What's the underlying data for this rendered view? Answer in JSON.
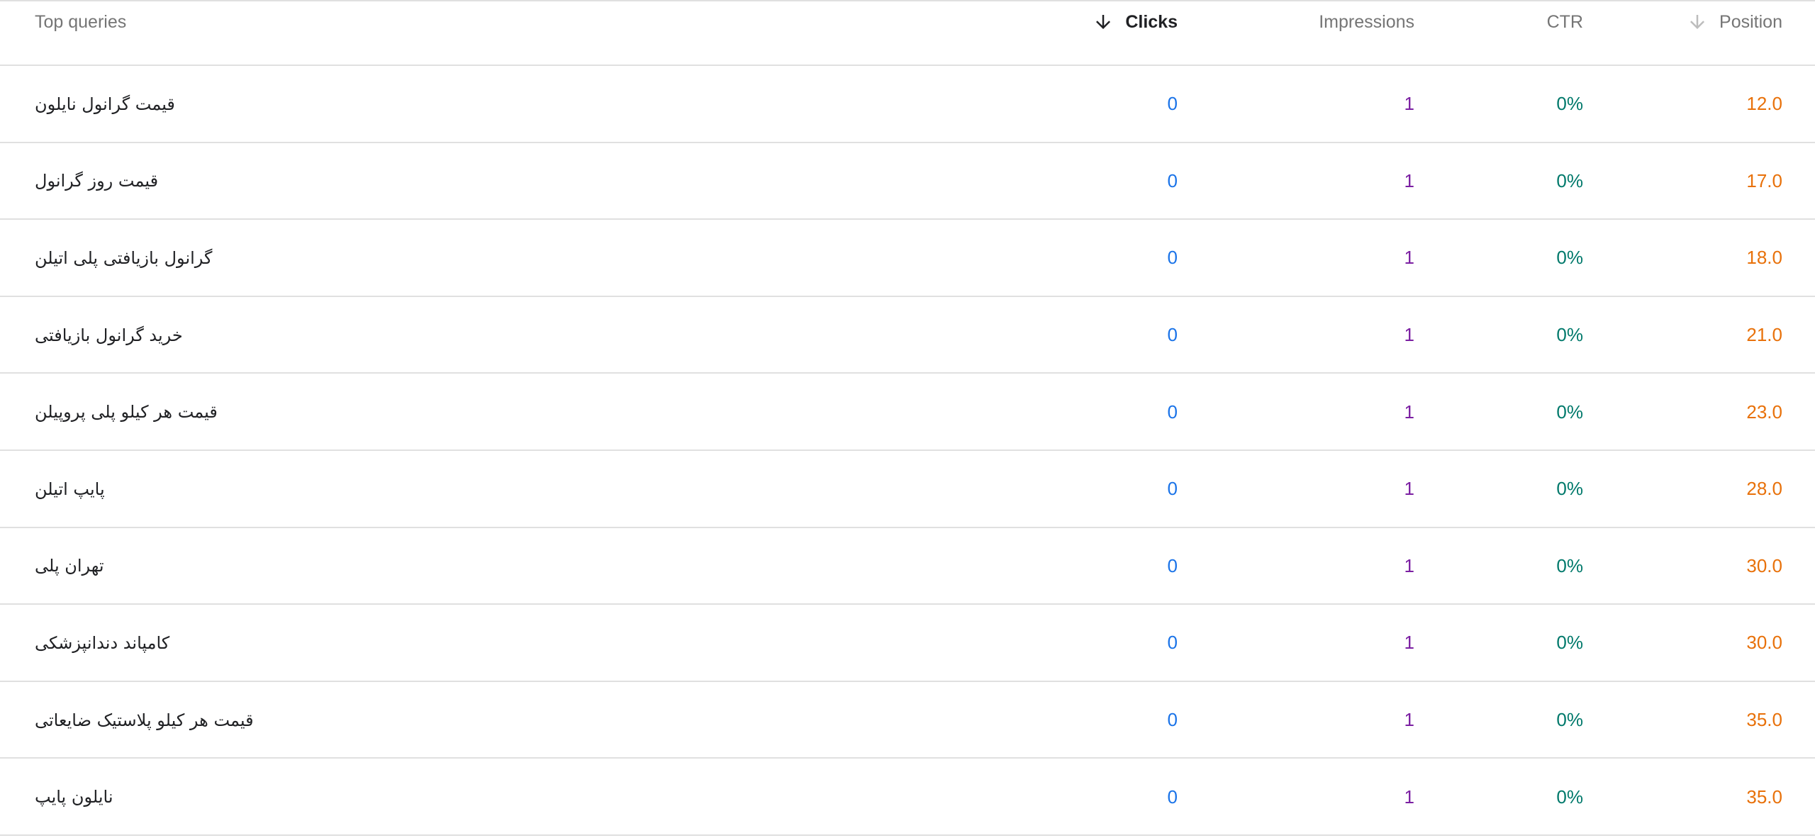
{
  "table": {
    "headers": {
      "query": "Top queries",
      "clicks": "Clicks",
      "impressions": "Impressions",
      "ctr": "CTR",
      "position": "Position"
    },
    "icons": {
      "clicks_sort": "arrow-down-icon",
      "position_sort": "arrow-down-icon"
    },
    "colors": {
      "clicks": "#1a73e8",
      "impressions": "#7b1fa2",
      "ctr": "#00796b",
      "position": "#e8710a"
    },
    "rows": [
      {
        "query": "قیمت گرانول نایلون",
        "clicks": "0",
        "impressions": "1",
        "ctr": "0%",
        "position": "12.0"
      },
      {
        "query": "قیمت روز گرانول",
        "clicks": "0",
        "impressions": "1",
        "ctr": "0%",
        "position": "17.0"
      },
      {
        "query": "گرانول بازیافتی پلی اتیلن",
        "clicks": "0",
        "impressions": "1",
        "ctr": "0%",
        "position": "18.0"
      },
      {
        "query": "خرید گرانول بازیافتی",
        "clicks": "0",
        "impressions": "1",
        "ctr": "0%",
        "position": "21.0"
      },
      {
        "query": "قیمت هر کیلو پلی پروپیلن",
        "clicks": "0",
        "impressions": "1",
        "ctr": "0%",
        "position": "23.0"
      },
      {
        "query": "پایپ اتیلن",
        "clicks": "0",
        "impressions": "1",
        "ctr": "0%",
        "position": "28.0"
      },
      {
        "query": "تهران پلی",
        "clicks": "0",
        "impressions": "1",
        "ctr": "0%",
        "position": "30.0"
      },
      {
        "query": "کامپاند دندانپزشکی",
        "clicks": "0",
        "impressions": "1",
        "ctr": "0%",
        "position": "30.0"
      },
      {
        "query": "قیمت هر کیلو پلاستیک ضایعاتی",
        "clicks": "0",
        "impressions": "1",
        "ctr": "0%",
        "position": "35.0"
      },
      {
        "query": "نایلون پایپ",
        "clicks": "0",
        "impressions": "1",
        "ctr": "0%",
        "position": "35.0"
      }
    ]
  }
}
